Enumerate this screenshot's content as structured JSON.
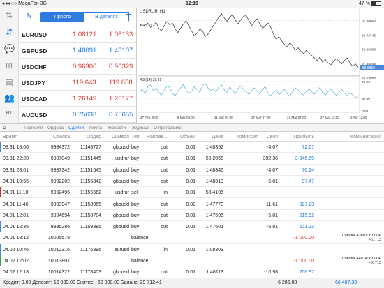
{
  "status": {
    "carrier": "MegaFon",
    "network": "3G",
    "time": "12:19",
    "battery": "47 %",
    "battery_level": 0.47
  },
  "toolbar": {
    "mode_simple": "Просто",
    "mode_detailed": "В деталях"
  },
  "quotes": [
    {
      "symbol": "EURUSD",
      "bid": "1.08121",
      "ask": "1.08133",
      "color": "red"
    },
    {
      "symbol": "GBPUSD",
      "bid": "1.48091",
      "ask": "1.48107",
      "color": "blue"
    },
    {
      "symbol": "USDCHF",
      "bid": "0.96306",
      "ask": "0.96329",
      "color": "red"
    },
    {
      "symbol": "USDJPY",
      "bid": "119.643",
      "ask": "119.658",
      "color": "red"
    },
    {
      "symbol": "USDCAD",
      "bid": "1.26149",
      "ask": "1.26177",
      "color": "red"
    },
    {
      "symbol": "AUDUSD",
      "bid": "0.75633",
      "ask": "0.75655",
      "color": "blue"
    }
  ],
  "chart": {
    "title": "USDRUR, H1",
    "price_tag": "58.8850",
    "indicator": "RSI(14) 32.91",
    "sell_label": "Sell 0.01",
    "y_labels": [
      "62.38890",
      "60.72745",
      "59.05000",
      "57.34545",
      "55.63800"
    ],
    "rsi_labels": [
      "70.00",
      "30.00",
      "0.00"
    ],
    "x_labels": [
      "27 Feb 2015",
      "6 Mar 05:00",
      "11 Mar 07:00",
      "17 Mar 07:00",
      "23 Mar 07:00",
      "27 Mar 11:00",
      "2 Apr 12:00"
    ],
    "colors": {
      "line": "#333333",
      "rsi": "#5aaed8",
      "hline": "#999999"
    },
    "price_series": [
      62.0,
      61.7,
      61.9,
      62.1,
      61.6,
      61.8,
      62.2,
      61.5,
      61.2,
      61.8,
      62.3,
      61.9,
      62.1,
      61.4,
      61.0,
      61.5,
      62.0,
      62.4,
      61.8,
      61.2,
      60.6,
      60.9,
      61.4,
      61.2,
      60.5,
      60.8,
      61.3,
      61.8,
      62.3,
      62.8,
      63.2,
      62.7,
      62.3,
      62.8,
      63.1,
      62.5,
      62.0,
      62.5,
      62.9,
      63.0,
      62.4,
      61.8,
      62.3,
      62.6,
      62.0,
      61.5,
      61.8,
      62.1,
      61.6,
      60.8,
      60.2,
      60.5,
      60.0,
      59.6,
      59.3,
      59.8,
      59.4,
      58.9,
      59.2,
      58.8,
      58.5,
      58.9,
      58.6,
      58.3,
      58.0,
      57.7,
      58.1,
      57.5,
      57.8,
      57.4,
      57.2,
      57.6,
      57.9,
      57.6,
      57.3,
      57.7,
      58.0,
      57.4,
      57.0,
      57.3,
      56.9
    ],
    "rsi_series": [
      45,
      52,
      40,
      58,
      62,
      48,
      55,
      44,
      38,
      50,
      60,
      56,
      42,
      36,
      48,
      55,
      63,
      50,
      41,
      47,
      58,
      52,
      44,
      60,
      66,
      55,
      48,
      52,
      45,
      58,
      62,
      50,
      44,
      57,
      49,
      41,
      53,
      60,
      52,
      46,
      39,
      48,
      55,
      47,
      40,
      52,
      58,
      43,
      36,
      44,
      50,
      38,
      45,
      52,
      41,
      35,
      47,
      55,
      50,
      42,
      38,
      47,
      53,
      45,
      40,
      48,
      56,
      44,
      38,
      46,
      52,
      43,
      37,
      45,
      51,
      42,
      36,
      44,
      38,
      33,
      33
    ]
  },
  "tabs": [
    "Торговля",
    "Ордера",
    "Сделки",
    "Почта",
    "Новости",
    "Журнал",
    "О программе"
  ],
  "active_tab": "Сделки",
  "columns": [
    "Время",
    "Сделка",
    "Ордер",
    "Символ",
    "Тип",
    "Направ...",
    "Объем",
    "Цена",
    "Комиссия",
    "Своп",
    "Прибыль",
    "Комментарий"
  ],
  "deals": [
    {
      "time": "03.31 18:06",
      "deal": "9984372",
      "order": "11148727",
      "symbol": "gbpusd",
      "type": "buy",
      "dir": "out",
      "vol": "0.01",
      "price": "1.48352",
      "comm": "",
      "swap": "-4.07",
      "profit": "72.67",
      "comment": "",
      "mark": "#4a88d8",
      "pcolor": "#1a73e8"
    },
    {
      "time": "03.31 22:28",
      "deal": "9987049",
      "order": "11151445",
      "symbol": "usdrur",
      "type": "buy",
      "dir": "out",
      "vol": "0.01",
      "price": "58.2055",
      "comm": "",
      "swap": "392.36",
      "profit": "3 346.59",
      "comment": "",
      "mark": "",
      "pcolor": "#1a73e8"
    },
    {
      "time": "03.31 23:01",
      "deal": "9987342",
      "order": "11151645",
      "symbol": "gbpusd",
      "type": "buy",
      "dir": "out",
      "vol": "0.01",
      "price": "1.48346",
      "comm": "",
      "swap": "-4.07",
      "profit": "76.24",
      "comment": "",
      "mark": "",
      "pcolor": "#1a73e8"
    },
    {
      "time": "04.01 10:55",
      "deal": "9992202",
      "order": "11156342",
      "symbol": "gbpusd",
      "type": "buy",
      "dir": "out",
      "vol": "0.01",
      "price": "1.48310",
      "comm": "",
      "swap": "-5.81",
      "profit": "97.47",
      "comment": "",
      "mark": "",
      "pcolor": "#1a73e8"
    },
    {
      "time": "04.01 11:10",
      "deal": "9992496",
      "order": "11156662",
      "symbol": "usdrur",
      "type": "sell",
      "dir": "in",
      "vol": "0.01",
      "price": "58.4105",
      "comm": "",
      "swap": "",
      "profit": "",
      "comment": "",
      "mark": "#d9342b",
      "pcolor": "#1a73e8"
    },
    {
      "time": "04.01 11:46",
      "deal": "9993947",
      "order": "11158065",
      "symbol": "gbpusd",
      "type": "buy",
      "dir": "out",
      "vol": "0.02",
      "price": "1.47770",
      "comm": "",
      "swap": "-11.61",
      "profit": "827.23",
      "comment": "",
      "mark": "",
      "pcolor": "#1a73e8"
    },
    {
      "time": "04.01 12:01",
      "deal": "9994694",
      "order": "11158784",
      "symbol": "gbpusd",
      "type": "buy",
      "dir": "out",
      "vol": "0.01",
      "price": "1.47595",
      "comm": "",
      "swap": "-5.81",
      "profit": "515.52",
      "comment": "",
      "mark": "",
      "pcolor": "#1a73e8"
    },
    {
      "time": "04.01 12:35",
      "deal": "9995286",
      "order": "11159385",
      "symbol": "gbpusd",
      "type": "buy",
      "dir": "out",
      "vol": "0.01",
      "price": "1.47601",
      "comm": "",
      "swap": "-5.81",
      "profit": "511.33",
      "comment": "",
      "mark": "#4a88d8",
      "pcolor": "#1a73e8"
    },
    {
      "time": "04.01 18:12",
      "deal": "10005578",
      "order": "",
      "symbol": "",
      "type": "balance",
      "dir": "",
      "vol": "",
      "price": "",
      "comm": "",
      "swap": "",
      "profit": "-1 000.00",
      "comment": "Transfer 43807: 61714->61713",
      "mark": "",
      "pcolor": "#d9342b"
    },
    {
      "time": "04.02 10:46",
      "deal": "10012316",
      "order": "11176396",
      "symbol": "eurusd",
      "type": "buy",
      "dir": "in",
      "vol": "0.01",
      "price": "1.08303",
      "comm": "",
      "swap": "",
      "profit": "",
      "comment": "",
      "mark": "#4a88d8",
      "pcolor": "#1a73e8"
    },
    {
      "time": "04.02 12:02",
      "deal": "10013801",
      "order": "",
      "symbol": "",
      "type": "balance",
      "dir": "",
      "vol": "",
      "price": "",
      "comm": "",
      "swap": "",
      "profit": "-1 000.00",
      "comment": "Transfer 44074: 61714->61713",
      "mark": "#3aa845",
      "pcolor": "#d9342b"
    },
    {
      "time": "04.02 12:18",
      "deal": "10014322",
      "order": "11178403",
      "symbol": "gbpusd",
      "type": "buy",
      "dir": "out",
      "vol": "0.01",
      "price": "1.48113",
      "comm": "",
      "swap": "-10.98",
      "profit": "206.97",
      "comment": "",
      "mark": "",
      "pcolor": "#1a73e8"
    }
  ],
  "footer": {
    "summary": "Кредит: 0.00  Депозит: 16 939.00  Снятие: -60 000.00  Баланс: 29 712.41",
    "swap_total": "6 286.08",
    "profit_total": "66 487.33"
  }
}
